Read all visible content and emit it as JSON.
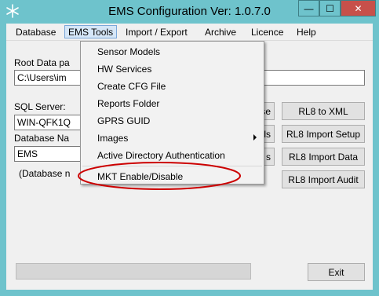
{
  "window": {
    "title": "EMS Configuration Ver: 1.0.7.0",
    "close_glyph": "✕",
    "max_glyph": "☐",
    "min_glyph": "—",
    "titlebar_color": "#6ec3cc",
    "close_color": "#c7504a"
  },
  "menubar": {
    "items": [
      "Database",
      "EMS Tools",
      "Import / Export",
      "Archive",
      "Licence",
      "Help"
    ],
    "open_item": "EMS Tools"
  },
  "form": {
    "root_label": "Root Data pa",
    "root_value": "C:\\Users\\im",
    "sql_label": "SQL Server:",
    "sql_value": "WIN-QFK1Q",
    "db_label": "Database Na",
    "db_value": "EMS",
    "db_note": "(Database n"
  },
  "buttons": {
    "partial_1": "se",
    "partial_2": "els",
    "partial_3": "s",
    "rl8_to_xml": "RL8 to XML",
    "rl8_import_setup": "RL8 Import Setup",
    "rl8_import_data": "RL8 Import Data",
    "rl8_import_audit": "RL8 Import Audit",
    "exit": "Exit"
  },
  "progress": {
    "value_percent": 0
  },
  "ems_tools_menu": {
    "items": [
      "Sensor Models",
      "HW Services",
      "Create CFG File",
      "Reports Folder",
      "GPRS GUID",
      "Images",
      "Active Directory Authentication",
      "MKT Enable/Disable"
    ],
    "highlighted": "Active Directory Authentication",
    "highlight_color": "#cc0000"
  }
}
